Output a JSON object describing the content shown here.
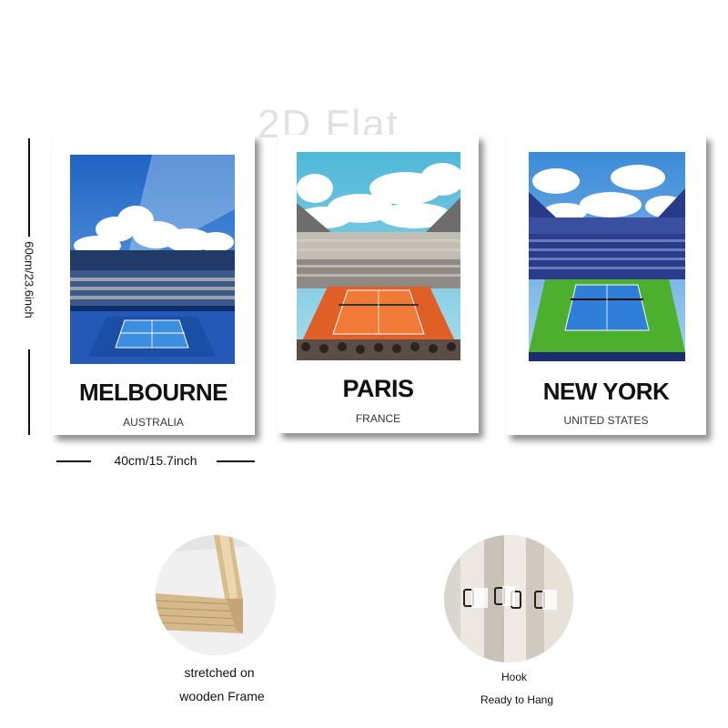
{
  "watermark": "2D Flat",
  "dimensions": {
    "height_label": "60cm/23.6inch",
    "width_label": "40cm/15.7inch"
  },
  "posters": [
    {
      "city": "MELBOURNE",
      "country": "AUSTRALIA"
    },
    {
      "city": "PARIS",
      "country": "FRANCE"
    },
    {
      "city": "NEW YORK",
      "country": "UNITED STATES"
    }
  ],
  "features": [
    {
      "caption_line1": "stretched on",
      "caption_line2": "wooden Frame",
      "icon": "wooden-frame-photo"
    },
    {
      "caption_line1": "Hook",
      "caption_line2": "Ready to Hang",
      "icon": "hook-photo"
    }
  ],
  "colors": {
    "melbourne_court": "#2f6fd0",
    "paris_clay": "#ee6a2a",
    "newyork_grass": "#4caf2e",
    "newyork_court": "#2f7fd8"
  }
}
